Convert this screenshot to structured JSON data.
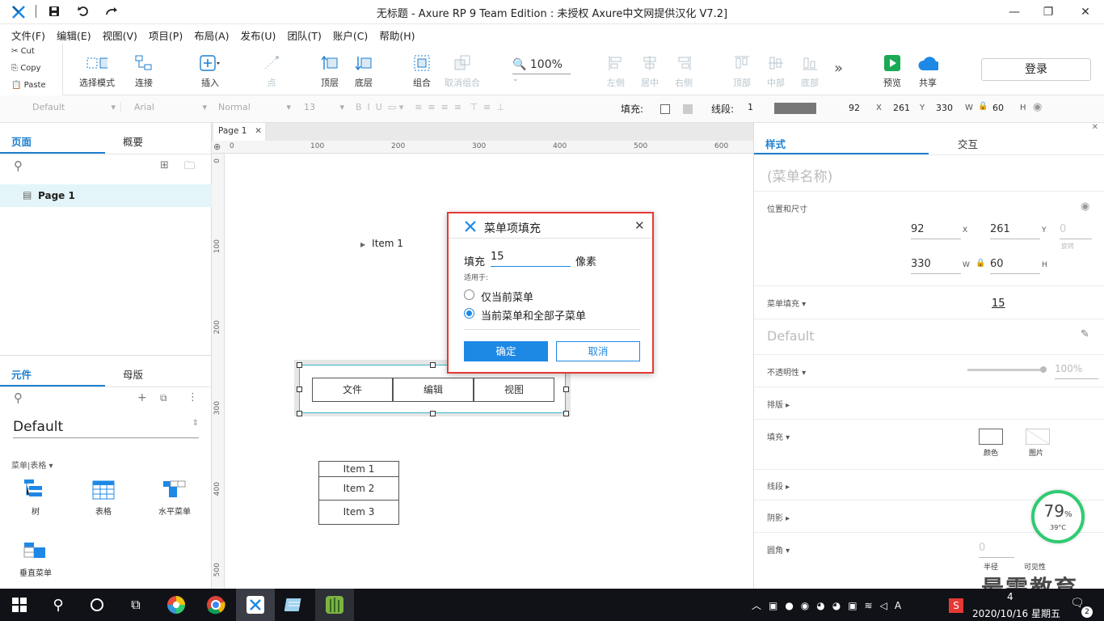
{
  "window": {
    "title": "无标题 - Axure RP 9 Team Edition : 未授权    Axure中文网提供汉化 V7.2]"
  },
  "menu": [
    "文件(F)",
    "编辑(E)",
    "视图(V)",
    "项目(P)",
    "布局(A)",
    "发布(U)",
    "团队(T)",
    "账户(C)",
    "帮助(H)"
  ],
  "clipboard": {
    "cut": "Cut",
    "copy": "Copy",
    "paste": "Paste"
  },
  "toolbar": {
    "select_mode": "选择模式",
    "connect": "连接",
    "insert": "插入",
    "point": "点",
    "top": "顶层",
    "bottom": "底层",
    "group": "组合",
    "ungroup": "取消组合",
    "zoom": "100%",
    "left": "左侧",
    "center": "居中",
    "right": "右侧",
    "vtop": "顶部",
    "middle": "中部",
    "vbottom": "底部",
    "more": "»",
    "preview": "预览",
    "share": "共享",
    "login": "登录"
  },
  "format": {
    "style": "Default",
    "font": "Arial",
    "weight": "Normal",
    "size": "13",
    "fill_label": "填充:",
    "stroke_label": "线段:",
    "stroke_value": "1",
    "x": "92",
    "x_label": "X",
    "y": "261",
    "y_label": "Y",
    "w": "330",
    "w_label": "W",
    "h": "60",
    "h_label": "H"
  },
  "left_panel": {
    "tab_pages": "页面",
    "tab_outline": "概要",
    "page_name": "Page 1",
    "tab_widgets": "元件",
    "tab_masters": "母版",
    "library": "Default",
    "category": "菜单|表格 ▾",
    "widgets": [
      "树",
      "表格",
      "水平菜单",
      "垂直菜单"
    ]
  },
  "canvas": {
    "tab": "Page 1",
    "ruler_h": [
      "0",
      "100",
      "200",
      "300",
      "400",
      "500",
      "600"
    ],
    "ruler_v": [
      "0",
      "100",
      "200",
      "300",
      "400",
      "500"
    ],
    "tree_item": "Item 1",
    "hmenu": [
      "文件",
      "编辑",
      "视图"
    ],
    "vmenu": [
      "Item 1",
      "Item 2",
      "Item 3"
    ]
  },
  "dialog": {
    "title": "菜单项填充",
    "fill_label": "填充",
    "fill_value": "15",
    "unit": "像素",
    "apply_to": "适用于:",
    "opt1": "仅当前菜单",
    "opt2": "当前菜单和全部子菜单",
    "ok": "确定",
    "cancel": "取消"
  },
  "right_panel": {
    "tab_style": "样式",
    "tab_interact": "交互",
    "name_placeholder": "(菜单名称)",
    "pos_size": "位置和尺寸",
    "x": "92",
    "y": "261",
    "rot": "0",
    "rot_label": "旋转",
    "w": "330",
    "h": "60",
    "x_label": "X",
    "y_label": "Y",
    "w_label": "W",
    "h_label": "H",
    "menu_fill": "菜单填充 ▾",
    "menu_fill_value": "15",
    "style_name": "Default",
    "opacity": "不透明性 ▾",
    "opacity_value": "100%",
    "typography": "排版 ▸",
    "fill": "填充 ▾",
    "fill_color": "颜色",
    "fill_image": "图片",
    "stroke": "线段 ▸",
    "shadow": "阴影 ▸",
    "corner": "圆角 ▾",
    "corner_value": "0",
    "corner_radius": "半径",
    "corner_visible": "可见性"
  },
  "overlay": {
    "cpu": "79",
    "pct": "%",
    "temp": "39°C",
    "watermark": "最需教育"
  },
  "taskbar": {
    "time": "4",
    "date": "2020/10/16 星期五",
    "badge": "2"
  }
}
